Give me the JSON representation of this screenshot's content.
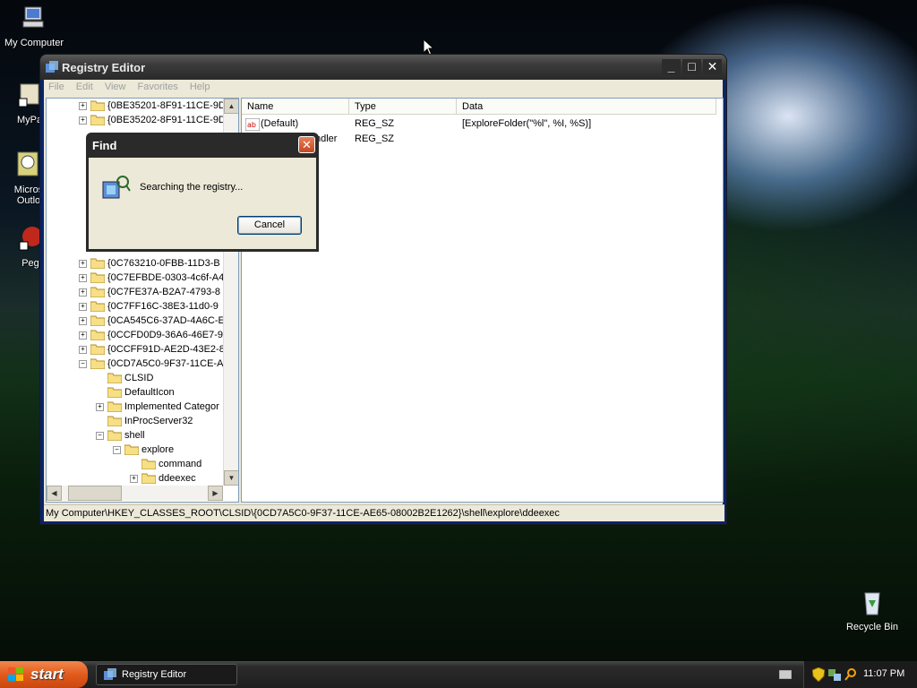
{
  "desktop": {
    "icons": [
      {
        "label": "My Computer"
      },
      {
        "label": "MyPa"
      },
      {
        "label": "Micros Outlo"
      },
      {
        "label": "Peg"
      },
      {
        "label": "Recycle Bin"
      }
    ]
  },
  "window": {
    "title": "Registry Editor",
    "menu": [
      "File",
      "Edit",
      "View",
      "Favorites",
      "Help"
    ]
  },
  "tree": {
    "items": [
      {
        "label": "{0BE35201-8F91-11CE-9D",
        "expander": "+"
      },
      {
        "label": "{0BE35202-8F91-11CE-9D",
        "expander": "+"
      },
      {
        "label": "{0C763210-0FBB-11D3-B",
        "expander": "+"
      },
      {
        "label": "{0C7EFBDE-0303-4c6f-A4",
        "expander": "+"
      },
      {
        "label": "{0C7FE37A-B2A7-4793-8",
        "expander": "+"
      },
      {
        "label": "{0C7FF16C-38E3-11d0-9",
        "expander": "+"
      },
      {
        "label": "{0CA545C6-37AD-4A6C-E",
        "expander": "+"
      },
      {
        "label": "{0CCFD0D9-36A6-46E7-9",
        "expander": "+"
      },
      {
        "label": "{0CCFF91D-AE2D-43E2-8",
        "expander": "+"
      },
      {
        "label": "{0CD7A5C0-9F37-11CE-A",
        "expander": "-"
      },
      {
        "label": "CLSID",
        "expander": ""
      },
      {
        "label": "DefaultIcon",
        "expander": ""
      },
      {
        "label": "Implemented Categor",
        "expander": "+"
      },
      {
        "label": "InProcServer32",
        "expander": ""
      },
      {
        "label": "shell",
        "expander": "-"
      },
      {
        "label": "explore",
        "expander": "-"
      },
      {
        "label": "command",
        "expander": ""
      },
      {
        "label": "ddeexec",
        "expander": "+"
      }
    ]
  },
  "list": {
    "headers": [
      "Name",
      "Type",
      "Data"
    ],
    "rows": [
      {
        "name": "(Default)",
        "type": "REG_SZ",
        "data": "[ExploreFolder(\"%l\", %I, %S)]"
      },
      {
        "name": "ndler",
        "type": "REG_SZ",
        "data": ""
      }
    ]
  },
  "status": {
    "path": "My Computer\\HKEY_CLASSES_ROOT\\CLSID\\{0CD7A5C0-9F37-11CE-AE65-08002B2E1262}\\shell\\explore\\ddeexec"
  },
  "dialog": {
    "title": "Find",
    "message": "Searching the registry...",
    "cancel_label": "Cancel"
  },
  "taskbar": {
    "start_label": "start",
    "task_label": "Registry Editor",
    "clock": "11:07 PM"
  },
  "colors": {
    "titlebar": "#3a3a3a",
    "start_button": "#e25a1c",
    "window_bg": "#ece9d8"
  }
}
